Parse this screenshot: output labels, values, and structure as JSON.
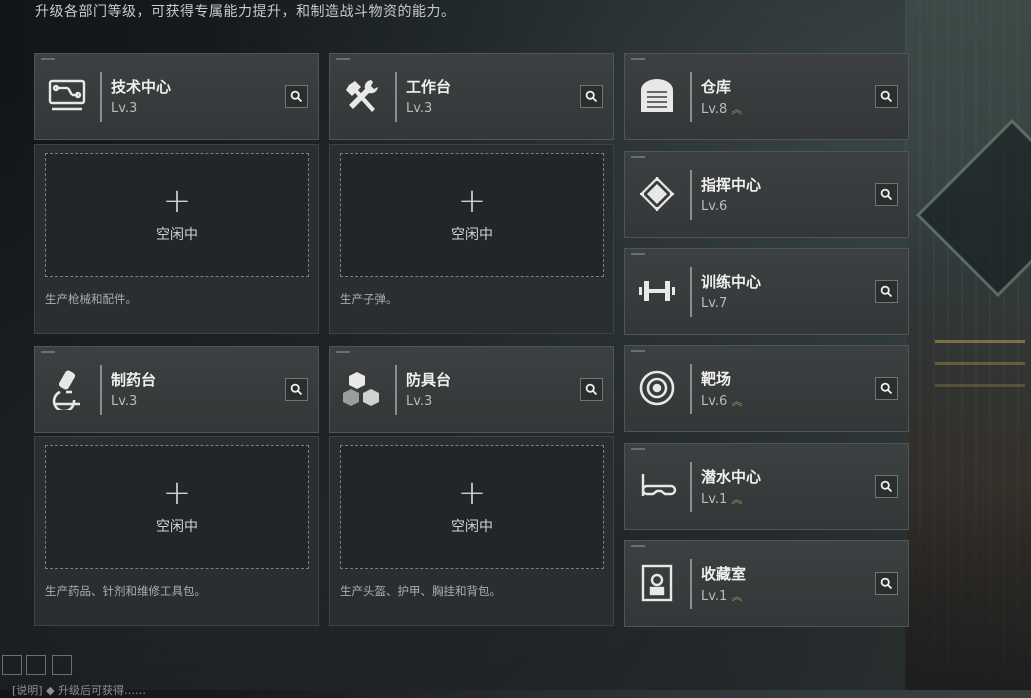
{
  "header": {
    "subtitle": "升级各部门等级，可获得专属能力提升，和制造战斗物资的能力。"
  },
  "production_cards": [
    {
      "name": "技术中心",
      "level": "Lv.3",
      "icon": "monitor-icon",
      "slot_label": "空闲中",
      "description": "生产枪械和配件。"
    },
    {
      "name": "工作台",
      "level": "Lv.3",
      "icon": "tools-icon",
      "slot_label": "空闲中",
      "description": "生产子弹。"
    },
    {
      "name": "制药台",
      "level": "Lv.3",
      "icon": "microscope-icon",
      "slot_label": "空闲中",
      "description": "生产药品、针剂和维修工具包。"
    },
    {
      "name": "防具台",
      "level": "Lv.3",
      "icon": "cubes-icon",
      "slot_label": "空闲中",
      "description": "生产头盔、护甲、胸挂和背包。"
    }
  ],
  "side_cards": [
    {
      "name": "仓库",
      "level": "Lv.8",
      "upgradable": true,
      "icon": "warehouse-icon"
    },
    {
      "name": "指挥中心",
      "level": "Lv.6",
      "upgradable": false,
      "icon": "chip-icon"
    },
    {
      "name": "训练中心",
      "level": "Lv.7",
      "upgradable": false,
      "icon": "dumbbell-icon"
    },
    {
      "name": "靶场",
      "level": "Lv.6",
      "upgradable": true,
      "icon": "target-icon"
    },
    {
      "name": "潜水中心",
      "level": "Lv.1",
      "upgradable": true,
      "icon": "diving-mask-icon"
    },
    {
      "name": "收藏室",
      "level": "Lv.1",
      "upgradable": true,
      "icon": "display-case-icon"
    }
  ],
  "footer": {
    "hint": "[说明] ◆ 升级后可获得……"
  },
  "colors": {
    "accent_upgrade": "#b39a5c",
    "card_bg": "#3c4041"
  }
}
